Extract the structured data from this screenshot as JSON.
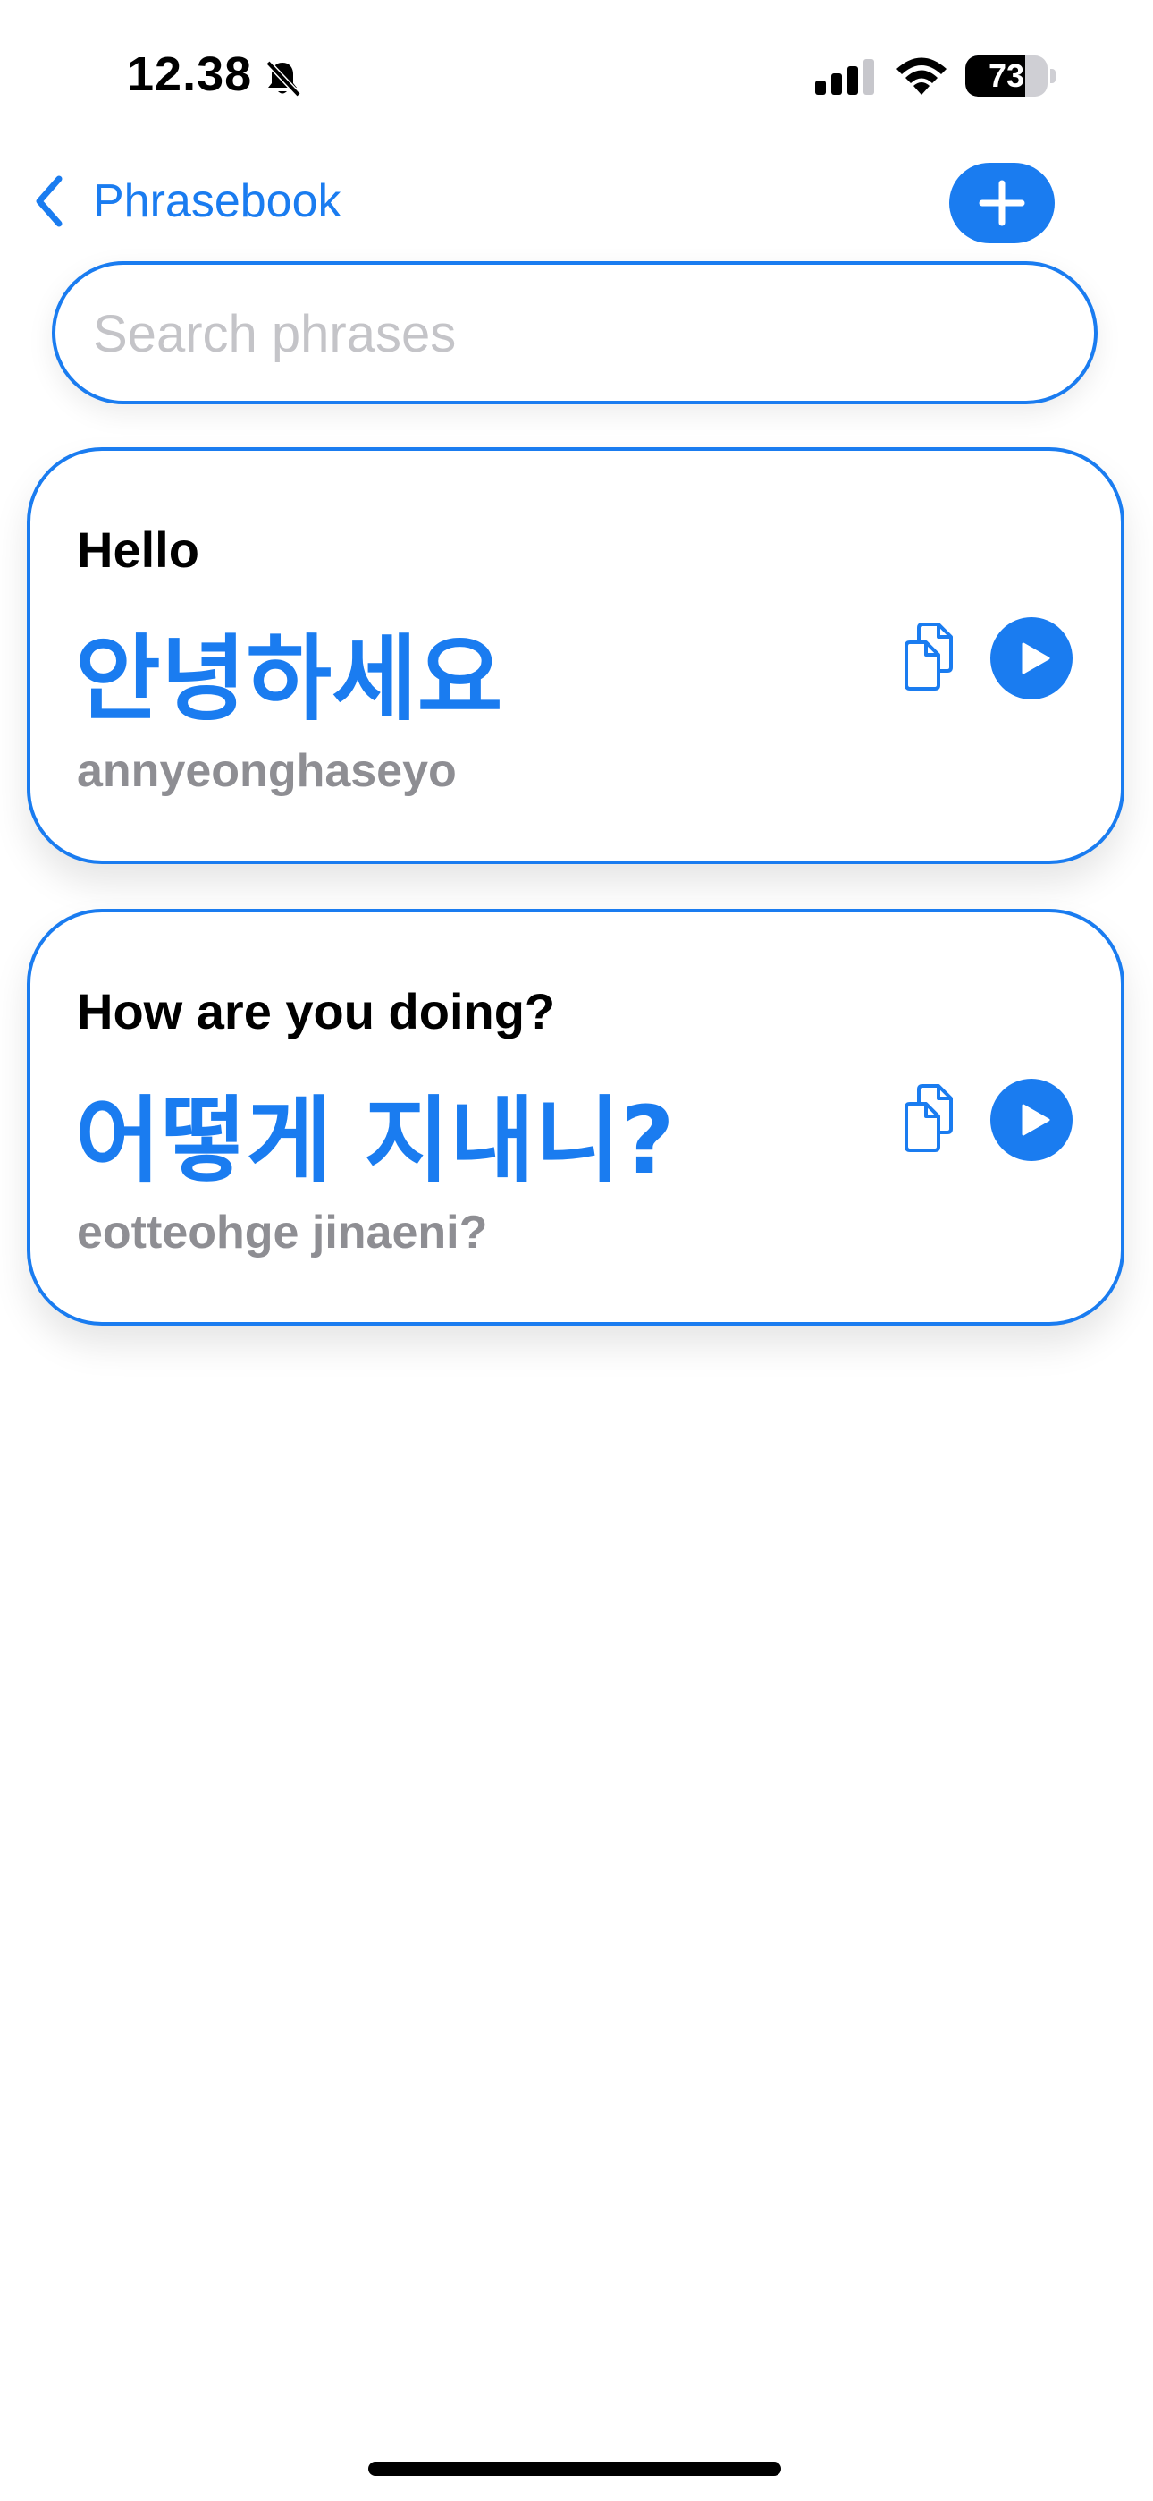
{
  "status_bar": {
    "time": "12.38",
    "battery_level": "73",
    "battery_fraction": 0.73
  },
  "nav": {
    "back_label": "Phrasebook"
  },
  "search": {
    "placeholder": "Search phrases",
    "value": ""
  },
  "phrases": [
    {
      "english": "Hello",
      "korean": "안녕하세요",
      "romanization": "annyeonghaseyo"
    },
    {
      "english": "How are you doing?",
      "korean": "어떻게 지내니?",
      "romanization": "eotteohge jinaeni?"
    }
  ],
  "colors": {
    "accent": "#1a7cf0",
    "secondary_text": "#8e8e93",
    "placeholder": "#c4c4c8"
  },
  "icons": {
    "back": "chevron-left-icon",
    "add": "plus-icon",
    "copy": "copy-icon",
    "play": "play-icon",
    "silent": "bell-slash-icon",
    "signal": "cellular-signal-icon",
    "wifi": "wifi-icon",
    "battery": "battery-icon"
  }
}
